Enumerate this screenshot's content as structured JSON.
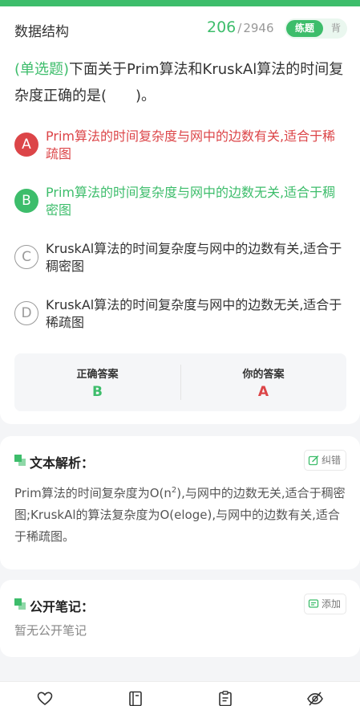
{
  "header": {
    "subject": "数据结构",
    "current_index": "206",
    "separator": "/",
    "total": "2946",
    "mode_practice": "练题",
    "mode_recite": "背"
  },
  "question": {
    "type_label": "(单选题)",
    "text": "下面关于Prim算法和KruskAl算法的时间复杂度正确的是(　　)。"
  },
  "options": [
    {
      "letter": "A",
      "text": "Prim算法的时间复杂度与网中的边数有关,适合于稀疏图",
      "state": "wrong"
    },
    {
      "letter": "B",
      "text": "Prim算法的时间复杂度与网中的边数无关,适合于稠密图",
      "state": "correct"
    },
    {
      "letter": "C",
      "text": "KruskAl算法的时间复杂度与网中的边数有关,适合于稠密图",
      "state": "none"
    },
    {
      "letter": "D",
      "text": "KruskAl算法的时间复杂度与网中的边数无关,适合于稀疏图",
      "state": "none"
    }
  ],
  "answer": {
    "correct_label": "正确答案",
    "correct_value": "B",
    "yours_label": "你的答案",
    "yours_value": "A"
  },
  "analysis": {
    "title": "文本解析：",
    "report_button": "纠错",
    "text_before": "Prim算法的时间复杂度为O(n",
    "text_sup": "2",
    "text_after": "),与网中的边数无关,适合于稠密图;KruskAl的算法复杂度为O(eloge),与网中的边数有关,适合于稀疏图。"
  },
  "notes": {
    "title": "公开笔记：",
    "add_button": "添加",
    "empty_text": "暂无公开笔记"
  },
  "bottom_bar": {
    "icons": [
      "heart-icon",
      "book-icon",
      "clipboard-icon",
      "eye-off-icon"
    ]
  },
  "colors": {
    "accent_green": "#3dbd6b",
    "wrong_red": "#dc4548"
  }
}
